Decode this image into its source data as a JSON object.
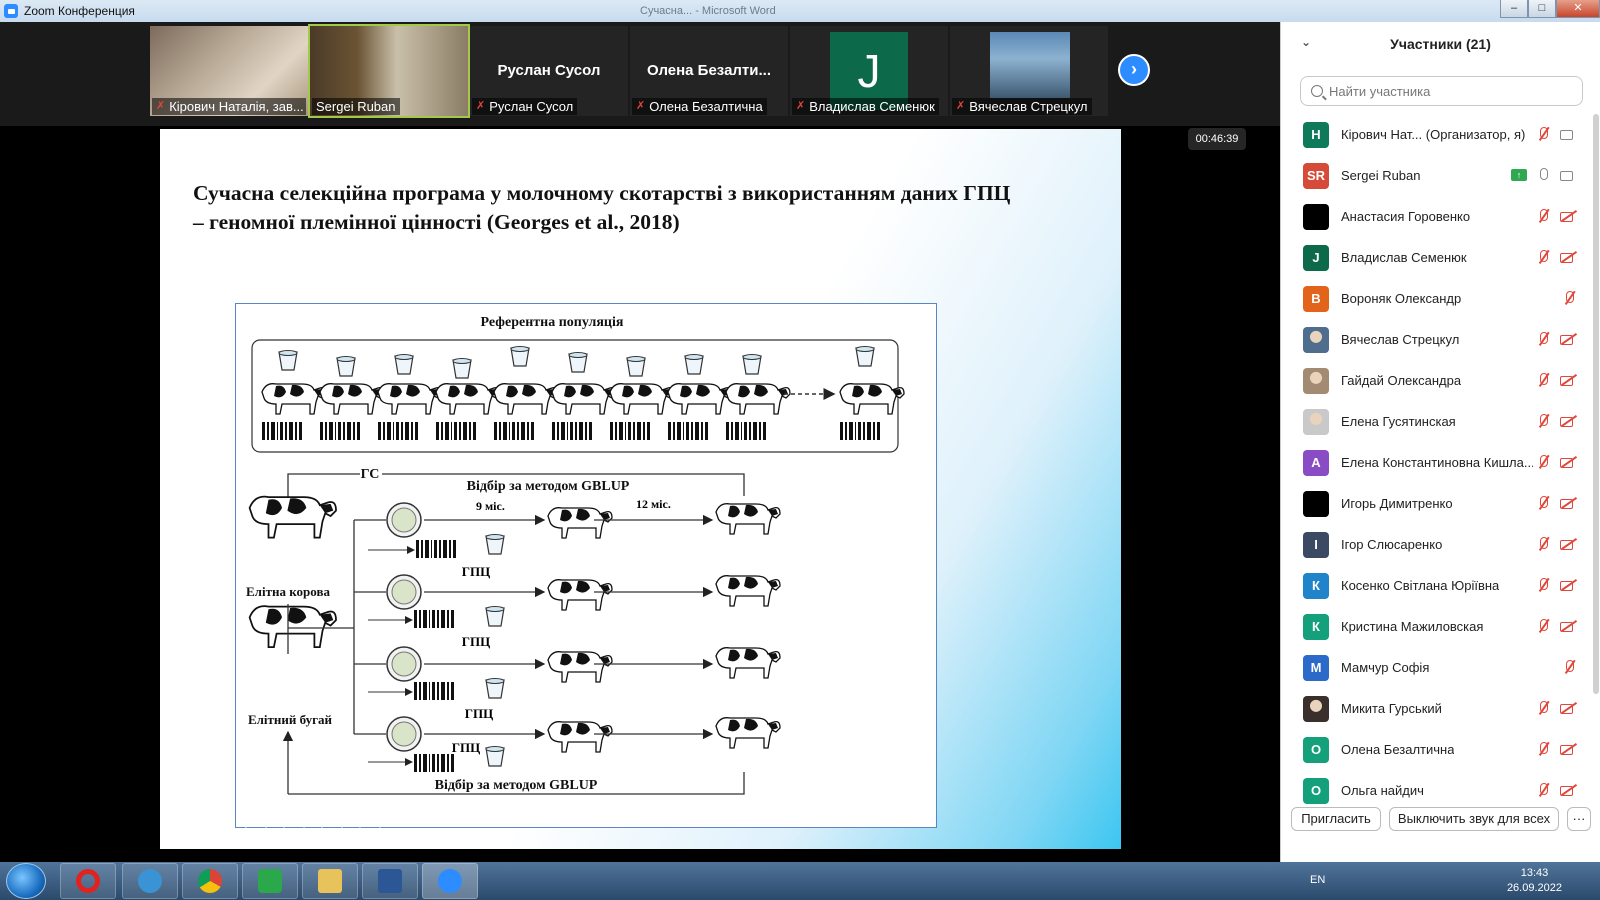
{
  "window": {
    "title": "Zoom Конференция",
    "background_title": "Сучасна... - Microsoft Word"
  },
  "strip": {
    "tiles": [
      {
        "caption": "Кірович Наталія, зав...",
        "big_name": "",
        "muted": true
      },
      {
        "caption": "Sergei Ruban",
        "big_name": "",
        "muted": false
      },
      {
        "caption": "Руслан Сусол",
        "big_name": "Руслан Сусол",
        "muted": true
      },
      {
        "caption": "Олена Безалтична",
        "big_name": "Олена  Безалти...",
        "muted": true
      },
      {
        "caption": "Владислав Семенюк",
        "big_name": "",
        "avatar_letter": "J",
        "muted": true
      },
      {
        "caption": "Вячеслав Стрецкул",
        "big_name": "",
        "muted": true
      }
    ],
    "next_icon": "chevron-right-icon"
  },
  "timer": "00:46:39",
  "slide": {
    "title": "Сучасна селекційна програма у молочному скотарстві з використанням даних ГПЦ – геномної племінної цінності (Georges et al., 2018)",
    "figure": {
      "ref_population": "Референтна популяція",
      "gs": "ГС",
      "top_method": "Відбір за методом GBLUP",
      "bottom_method": "Відбір за методом GBLUP",
      "age_9": "9 міс.",
      "age_12": "12 міс.",
      "elite_cow": "Елітна корова",
      "elite_bull": "Елітний бугай",
      "gpc": "ГПЦ"
    }
  },
  "panel": {
    "title": "Участники (21)",
    "search_placeholder": "Найти участника",
    "participants": [
      {
        "initials": "H",
        "name": "Кірович Нат...   (Организатор, я)",
        "color": "#0e7a5a",
        "mic": "off",
        "cam": "on"
      },
      {
        "initials": "SR",
        "name": "Sergei Ruban",
        "color": "#d64a3a",
        "mic": "on",
        "cam": "on",
        "share": true
      },
      {
        "initials": "",
        "name": "Анастасия Горовенко",
        "color": "#000000",
        "mic": "off",
        "cam": "off"
      },
      {
        "initials": "J",
        "name": "Владислав Семенюк",
        "color": "#0c6a4b",
        "mic": "off",
        "cam": "off"
      },
      {
        "initials": "В",
        "name": "Вороняк Олександр",
        "color": "#e2641b",
        "mic": "off",
        "cam": "none"
      },
      {
        "initials": "",
        "name": "Вячеслав Стрецкул",
        "color": "#4f6e8e",
        "mic": "off",
        "cam": "off",
        "photo": true
      },
      {
        "initials": "",
        "name": "Гайдай Олександра",
        "color": "#a38a72",
        "mic": "off",
        "cam": "off",
        "photo": true
      },
      {
        "initials": "",
        "name": "Елена Гусятинская",
        "color": "#c9c9c9",
        "mic": "off",
        "cam": "off",
        "photo": true
      },
      {
        "initials": "А",
        "name": "Елена Константиновна Кишла...",
        "color": "#8a4cc4",
        "mic": "off",
        "cam": "off"
      },
      {
        "initials": "",
        "name": "Игорь Димитренко",
        "color": "#000000",
        "mic": "off",
        "cam": "off"
      },
      {
        "initials": "I",
        "name": "Ігор Слюсаренко",
        "color": "#3b4a62",
        "mic": "off",
        "cam": "off"
      },
      {
        "initials": "К",
        "name": "Косенко Світлана Юріївна",
        "color": "#1f84c9",
        "mic": "off",
        "cam": "off"
      },
      {
        "initials": "К",
        "name": "Кристина Мажиловская",
        "color": "#14a07a",
        "mic": "off",
        "cam": "off"
      },
      {
        "initials": "М",
        "name": "Мамчур Софія",
        "color": "#2b6ac9",
        "mic": "off",
        "cam": "none"
      },
      {
        "initials": "",
        "name": "Микита Гурський",
        "color": "#3a2f2a",
        "mic": "off",
        "cam": "off",
        "photo": true
      },
      {
        "initials": "О",
        "name": "Олена Безалтична",
        "color": "#14a07a",
        "mic": "off",
        "cam": "off"
      },
      {
        "initials": "О",
        "name": "Ольга найдич",
        "color": "#14a07a",
        "mic": "off",
        "cam": "off"
      }
    ],
    "invite_label": "Пригласить",
    "mute_all_label": "Выключить звук для всех",
    "more_label": "···"
  },
  "taskbar": {
    "lang": "EN",
    "time": "13:43",
    "date": "26.09.2022"
  }
}
